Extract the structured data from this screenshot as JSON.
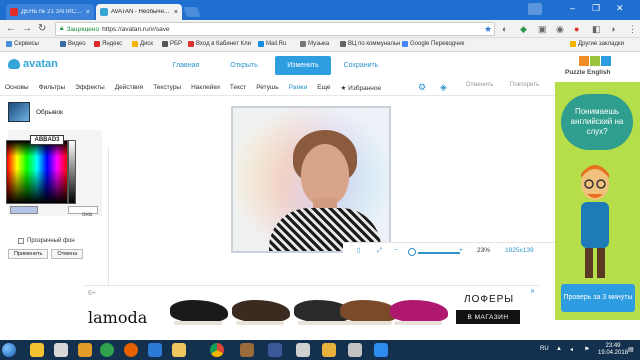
{
  "browser": {
    "tabs": [
      {
        "title": "ДЕНЬ № 21 ЗАПИСЬ С",
        "favicon_color": "#e52d27"
      },
      {
        "title": "AVATAN - Необычный",
        "favicon_color": "#36a6d9"
      }
    ],
    "address": {
      "secure_label": "Защищено",
      "url": "https://avatan.ru/#/save"
    },
    "bookmarks": [
      {
        "label": "Сервисы",
        "color": "#4a8ddd"
      },
      {
        "label": "Видео",
        "color": "#3b6ea5"
      },
      {
        "label": "Яндекс",
        "color": "#e02a2a"
      },
      {
        "label": "Диск",
        "color": "#f4b400"
      },
      {
        "label": "РБР",
        "color": "#555555"
      },
      {
        "label": "Вход в Кабинет Кли",
        "color": "#d33"
      },
      {
        "label": "Mail.Ru",
        "color": "#168de2"
      },
      {
        "label": "Музыка",
        "color": "#777777"
      },
      {
        "label": "ВЦ по коммунальн",
        "color": "#666666"
      },
      {
        "label": "Google Переводчик",
        "color": "#4285f4"
      },
      {
        "label": "Другие закладки",
        "color": "#f4b400"
      }
    ]
  },
  "app": {
    "logo": "avatan",
    "topnav": [
      "Главная",
      "Открыть",
      "Изменить",
      "Сохранить"
    ],
    "active_topnav": "Изменить",
    "tools": [
      "Основы",
      "Фильтры",
      "Эффекты",
      "Действия",
      "Текстуры",
      "Наклейки",
      "Текст",
      "Ретушь",
      "Рамки",
      "Еще",
      "Избранное"
    ],
    "active_tool": "Рамки",
    "undo_label": "Отменить",
    "redo_label": "Повторить",
    "panel": {
      "frame_name": "Обрывок",
      "hex_value": "ABBAD3",
      "swatch_color": "#b5c6e8",
      "side_text": "она",
      "transparent_label": "Прозрачный фон",
      "apply_label": "Применить",
      "cancel_label": "Отмена"
    },
    "zoom": {
      "percent": "23%",
      "dimensions": "1825x139",
      "level": 0.23
    }
  },
  "ads": {
    "right": {
      "brand": "Puzzle English",
      "bubble": "Понимаешь английский на слух?",
      "cta": "Проверь за 3 минуты"
    },
    "banner": {
      "brand": "lamoda",
      "mark": "6+",
      "heading": "ЛОФЕРЫ",
      "cta": "В МАГАЗИН",
      "shoe_colors": [
        "#1a1a1a",
        "#3a2a20",
        "#2a2a2a",
        "#7b4a2a",
        "#b0186f"
      ]
    }
  },
  "taskbar": {
    "lang": "RU",
    "time": "23:49",
    "date": "19.04.2018"
  }
}
